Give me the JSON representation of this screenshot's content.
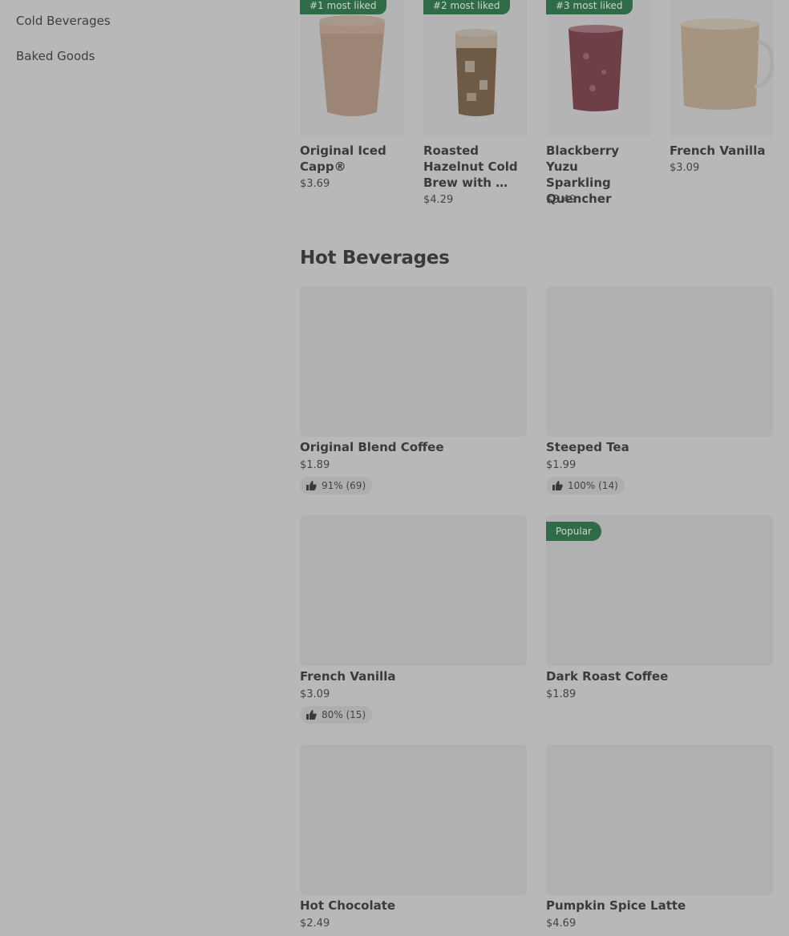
{
  "sidebar": {
    "items": [
      {
        "label": "Cold Beverages"
      },
      {
        "label": "Baked Goods"
      }
    ]
  },
  "carousel": {
    "items": [
      {
        "badge": "#1 most liked",
        "name": "Original Iced Capp®",
        "price": "$3.69",
        "icon": "iced-capp-image"
      },
      {
        "badge": "#2 most liked",
        "name": "Roasted Hazelnut Cold Brew with …",
        "price": "$4.29",
        "icon": "cold-brew-image"
      },
      {
        "badge": "#3 most liked",
        "name": "Blackberry Yuzu Sparkling Quencher",
        "price": "$3.49",
        "icon": "quencher-image"
      },
      {
        "badge": "",
        "name": "French Vanilla",
        "price": "$3.09",
        "icon": "vanilla-mug-image"
      }
    ]
  },
  "hot_beverages": {
    "title": "Hot Beverages",
    "items": [
      {
        "name": "Original Blend Coffee",
        "price": "$1.89",
        "rating": "91% (69)",
        "badge": ""
      },
      {
        "name": "Steeped Tea",
        "price": "$1.99",
        "rating": "100% (14)",
        "badge": ""
      },
      {
        "name": "French Vanilla",
        "price": "$3.09",
        "rating": "80% (15)",
        "badge": ""
      },
      {
        "name": "Dark Roast Coffee",
        "price": "$1.89",
        "rating": "",
        "badge": "Popular"
      },
      {
        "name": "Hot Chocolate",
        "price": "$2.49",
        "rating": "",
        "badge": ""
      },
      {
        "name": "Pumpkin Spice Latte",
        "price": "$4.69",
        "rating": "",
        "badge": ""
      }
    ]
  },
  "colors": {
    "background": "#b8b8b8",
    "badge": "#2f6b47",
    "card_placeholder": "#b0b0b0"
  }
}
